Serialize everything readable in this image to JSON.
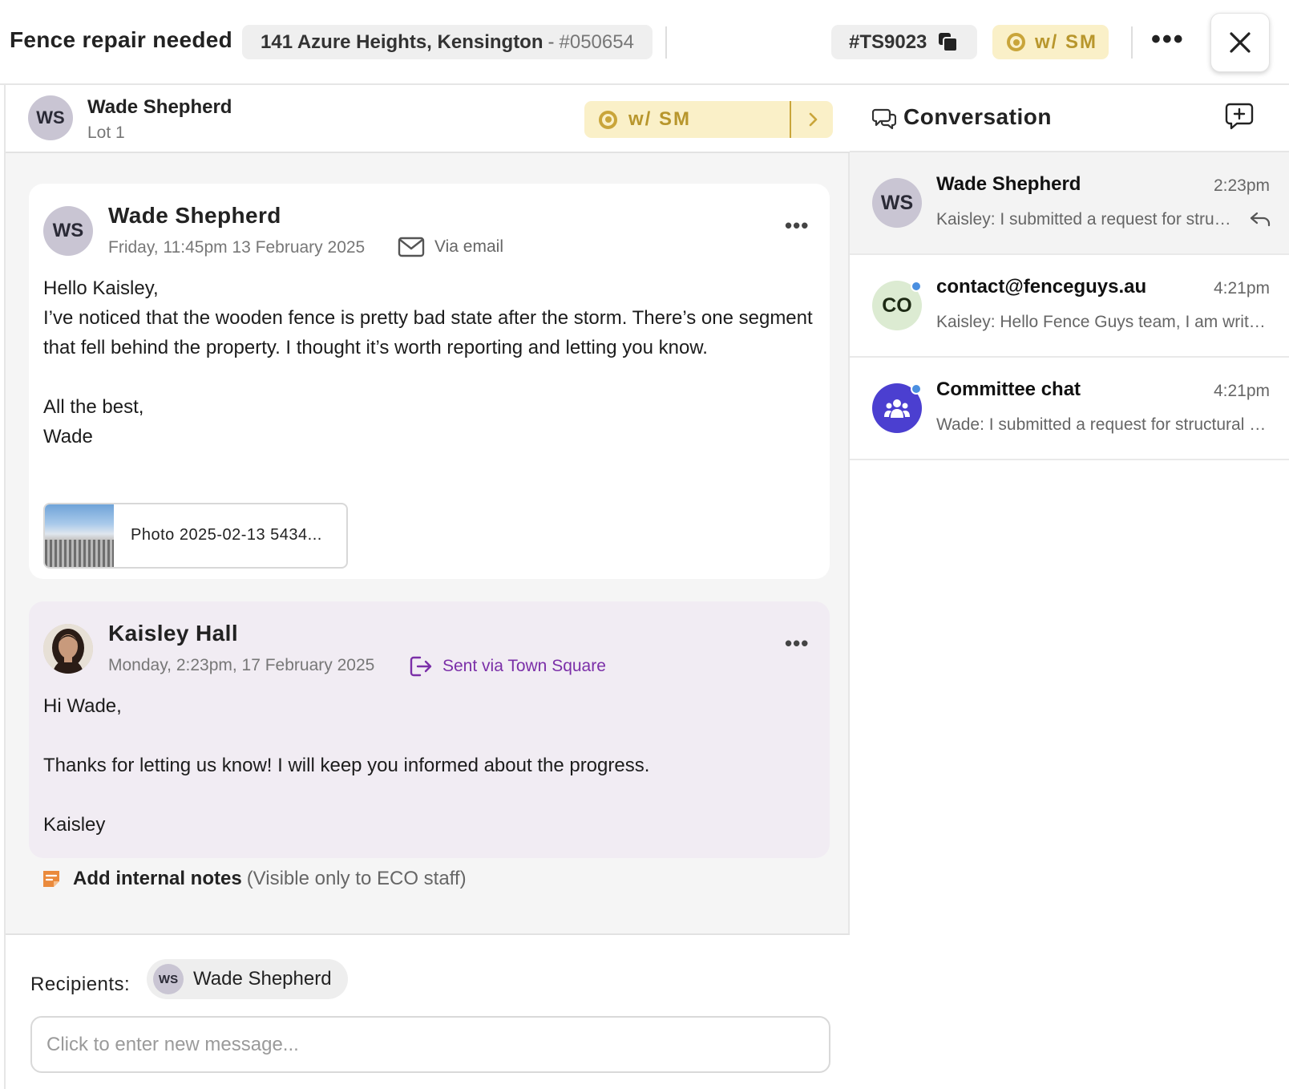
{
  "header": {
    "title": "Fence repair needed",
    "address": "141 Azure Heights, Kensington",
    "address_separator": "-",
    "property_code": "#050654",
    "ticket_id": "#TS9023",
    "status_label": "w/ SM"
  },
  "contact": {
    "initials": "WS",
    "name": "Wade Shepherd",
    "lot": "Lot 1",
    "status_label": "w/ SM"
  },
  "messages": [
    {
      "initials": "WS",
      "sender": "Wade Shepherd",
      "date": "Friday, 11:45pm 13 February 2025",
      "via": "Via email",
      "paragraphs": [
        "Hello Kaisley,\nI’ve noticed that the wooden fence is pretty bad state after the storm. There’s one segment that fell behind the property. I thought it’s worth reporting and letting you know.",
        "All the best,\nWade"
      ],
      "attachment": "Photo 2025-02-13 5434..."
    },
    {
      "sender": "Kaisley Hall",
      "date": "Monday, 2:23pm, 17 February 2025",
      "via": "Sent via Town Square",
      "paragraphs": [
        "Hi Wade,",
        "Thanks for letting us know! I will keep you informed about the progress.",
        "Kaisley"
      ]
    }
  ],
  "internal_notes": {
    "label": "Add internal notes",
    "hint": "(Visible only to ECO staff)"
  },
  "composer": {
    "recipients_label": "Recipients:",
    "recipient_initials": "WS",
    "recipient_name": "Wade Shepherd",
    "placeholder": "Click to enter new message..."
  },
  "conversation": {
    "title": "Conversation",
    "items": [
      {
        "initials": "WS",
        "name": "Wade Shepherd",
        "time": "2:23pm",
        "preview": "Kaisley: I submitted a request for structural repairs"
      },
      {
        "initials": "CO",
        "name": "contact@fenceguys.au",
        "time": "4:21pm",
        "preview": "Kaisley: Hello Fence Guys team, I am writing to you"
      },
      {
        "name": "Committee chat",
        "time": "4:21pm",
        "preview": "Wade: I submitted a request for structural repairs"
      }
    ]
  },
  "colors": {
    "status_bg": "#faf0c8",
    "status_fg": "#b8962c",
    "town_square": "#7b2fa8",
    "committee": "#4b3fd0",
    "unread_dot": "#4a8fe0",
    "notes_icon": "#ea8a3c"
  }
}
